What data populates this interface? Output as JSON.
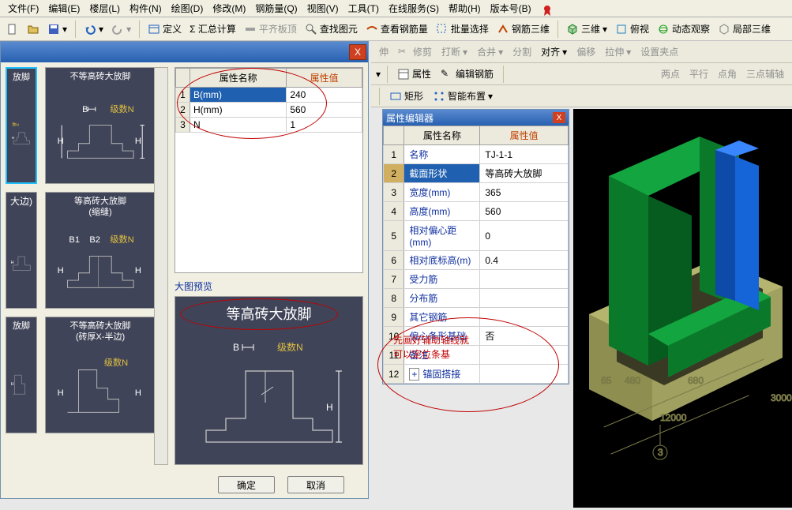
{
  "menu": [
    "文件(F)",
    "编辑(E)",
    "楼层(L)",
    "构件(N)",
    "绘图(D)",
    "修改(M)",
    "钢筋量(Q)",
    "视图(V)",
    "工具(T)",
    "在线服务(S)",
    "帮助(H)",
    "版本号(B)"
  ],
  "toolbar1": {
    "define": "定义",
    "sumcalc": "Σ 汇总计算",
    "flatplate": "平齐板顶",
    "findgraph": "查找图元",
    "viewrebar": "查看钢筋量",
    "batchsel": "批量选择",
    "rebar3d": "钢筋三维",
    "view3d": "三维",
    "top": "俯视",
    "dynview": "动态观察",
    "local3d": "局部三维"
  },
  "toolbar2a": {
    "extend": "伸",
    "trim": "修剪",
    "break": "打断",
    "merge": "合并",
    "split": "分割",
    "align": "对齐",
    "offset": "偏移",
    "stretch": "拉伸",
    "setgrip": "设置夹点"
  },
  "toolbar2b": {
    "attr": "属性",
    "editrebar": "编辑钢筋",
    "two": "两点",
    "parallel": "平行",
    "pt": "点角",
    "three": "三点辅轴"
  },
  "toolbar2c": {
    "rect": "矩形",
    "smart": "智能布置"
  },
  "leftDialog": {
    "closeGlyph": "X",
    "thumbs": [
      "放脚",
      "不等高砖大放脚",
      "大边)",
      "等高砖大放脚\n(缩缝)",
      "放脚",
      "不等高砖大放脚\n(砖厚X-半边)"
    ],
    "diagLabels": {
      "B": "B",
      "H": "H",
      "N": "级数N",
      "B1": "B1",
      "B2": "B2"
    },
    "propHeader": {
      "name": "属性名称",
      "value": "属性值"
    },
    "rows": [
      {
        "name": "B(mm)",
        "value": "240"
      },
      {
        "name": "H(mm)",
        "value": "560"
      },
      {
        "name": "N",
        "value": "1"
      }
    ],
    "previewLabel": "大图预览",
    "previewTitle": "等高砖大放脚",
    "ok": "确定",
    "cancel": "取消"
  },
  "propEditor": {
    "title": "属性编辑器",
    "closeGlyph": "X",
    "header": {
      "name": "属性名称",
      "value": "属性值"
    },
    "rows": [
      {
        "name": "名称",
        "value": "TJ-1-1"
      },
      {
        "name": "截面形状",
        "value": "等高砖大放脚"
      },
      {
        "name": "宽度(mm)",
        "value": "365"
      },
      {
        "name": "高度(mm)",
        "value": "560"
      },
      {
        "name": "相对偏心距(mm)",
        "value": "0"
      },
      {
        "name": "相对底标高(m)",
        "value": "0.4"
      },
      {
        "name": "受力筋",
        "value": ""
      },
      {
        "name": "分布筋",
        "value": ""
      },
      {
        "name": "其它钢筋",
        "value": ""
      },
      {
        "name": "偏心条形基础",
        "value": "否"
      },
      {
        "name": "备注",
        "value": ""
      },
      {
        "name": "锚固搭接",
        "value": ""
      }
    ],
    "expandGlyph": "+"
  },
  "annotation": {
    "l1": "先画好辅助轴线就",
    "l2": "可以定位条基"
  },
  "viewport": {
    "dims": {
      "d1": "65",
      "d2": "480",
      "d3": "680",
      "d4": "12000",
      "d5": "3000"
    },
    "axis": "3"
  }
}
